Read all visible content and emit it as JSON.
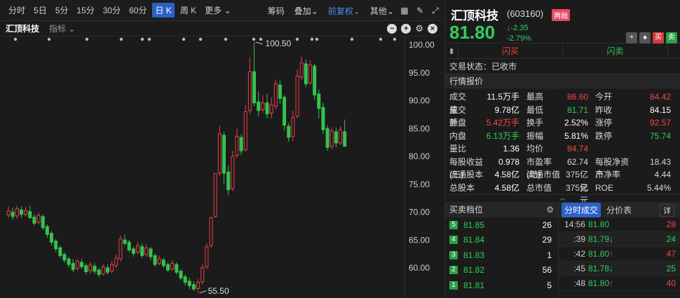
{
  "toolbar": {
    "items": [
      "分时",
      "5日",
      "5分",
      "15分",
      "30分",
      "60分",
      "日 K",
      "周 K",
      "更多"
    ],
    "active": "日 K",
    "right": [
      "筹码",
      "叠加",
      "前复权",
      "其他"
    ],
    "right_active": "前复权"
  },
  "subbar": {
    "stock": "汇顶科技",
    "indicator": "指标"
  },
  "stock": {
    "name": "汇顶科技",
    "code": "(603160)",
    "badge": "两融",
    "price": "81.80",
    "change": "-2.35",
    "change_pct": "-2.79%"
  },
  "trade": {
    "buy": "闪买",
    "sell": "闪卖"
  },
  "status": "交易状态：已收市",
  "quote_title": "行情报价",
  "quotes": [
    {
      "l1": "成交量",
      "v1": "11.5万手",
      "l2": "最高",
      "v2": "86.60",
      "c2": "red",
      "l3": "今开",
      "v3": "84.42",
      "c3": "red"
    },
    {
      "l1": "成交额",
      "v1": "9.78亿",
      "l2": "最低",
      "v2": "81.71",
      "c2": "green",
      "l3": "昨收",
      "v3": "84.15",
      "c3": "white"
    },
    {
      "l1": "外盘",
      "v1": "5.42万手",
      "c1": "red",
      "l2": "换手",
      "v2": "2.52%",
      "c2": "white",
      "l3": "涨停",
      "v3": "92.57",
      "c3": "red"
    },
    {
      "l1": "内盘",
      "v1": "6.13万手",
      "c1": "green",
      "l2": "振幅",
      "v2": "5.81%",
      "c2": "white",
      "l3": "跌停",
      "v3": "75.74",
      "c3": "green"
    },
    {
      "l1": "量比",
      "v1": "1.36",
      "l2": "均价",
      "v2": "84.74",
      "c2": "red",
      "l3": "",
      "v3": ""
    }
  ],
  "quotes_wide": [
    {
      "l1": "每股收益(三)",
      "v1": "0.978",
      "l2": "市盈率(动)",
      "v2": "62.74",
      "l3": "每股净资产",
      "v3": "18.43"
    },
    {
      "l1": "流通股本",
      "v1": "4.58亿",
      "l2": "流通市值",
      "v2": "375亿元",
      "l3": "市净率",
      "v3": "4.44"
    },
    {
      "l1": "总股本",
      "v1": "4.58亿",
      "l2": "总市值",
      "v2": "375亿元",
      "l3": "ROE",
      "v3": "5.44%"
    }
  ],
  "book": {
    "title": "买卖档位",
    "rows": [
      {
        "lvl": "5",
        "price": "81.85",
        "vol": "26"
      },
      {
        "lvl": "4",
        "price": "81.84",
        "vol": "29"
      },
      {
        "lvl": "3",
        "price": "81.83",
        "vol": "1"
      },
      {
        "lvl": "2",
        "price": "81.82",
        "vol": "56"
      },
      {
        "lvl": "1",
        "price": "81.81",
        "vol": "5"
      }
    ]
  },
  "ticks": {
    "tab1": "分时成交",
    "tab2": "分价表",
    "detail": "详",
    "rows": [
      {
        "t": "14:56",
        "p": "81.80",
        "d": "",
        "v": "28",
        "vc": "red"
      },
      {
        "t": ":39",
        "p": "81.79",
        "d": "↓",
        "v": "24",
        "vc": "green"
      },
      {
        "t": ":42",
        "p": "81.80",
        "d": "↑",
        "v": "47",
        "vc": "red"
      },
      {
        "t": ":45",
        "p": "81.78",
        "d": "↓",
        "v": "25",
        "vc": "green"
      },
      {
        "t": ":48",
        "p": "81.80",
        "d": "↑",
        "v": "40",
        "vc": "red"
      }
    ]
  },
  "chart_data": {
    "type": "candlestick",
    "y_ticks": [
      "100.00",
      "95.00",
      "90.00",
      "85.00",
      "80.00",
      "75.00",
      "70.00",
      "65.00",
      "60.00"
    ],
    "ylim": [
      58,
      101
    ],
    "annotations": [
      {
        "label": "100.50",
        "value": 100.5
      },
      {
        "label": "55.50",
        "value": 55.5
      }
    ],
    "candles": [
      [
        69.5,
        70.2,
        71.0,
        69.0
      ],
      [
        70.0,
        69.2,
        70.8,
        68.6
      ],
      [
        69.3,
        70.6,
        71.2,
        68.8
      ],
      [
        70.4,
        69.6,
        71.0,
        69.0
      ],
      [
        69.6,
        70.3,
        70.9,
        69.2
      ],
      [
        70.1,
        69.0,
        71.2,
        68.8
      ],
      [
        69.1,
        68.0,
        69.6,
        67.6
      ],
      [
        68.2,
        69.4,
        69.9,
        67.8
      ],
      [
        69.2,
        67.2,
        69.6,
        66.8
      ],
      [
        67.4,
        66.0,
        67.8,
        65.4
      ],
      [
        66.2,
        64.6,
        66.6,
        64.0
      ],
      [
        64.8,
        63.4,
        65.2,
        62.9
      ],
      [
        63.6,
        62.2,
        64.0,
        61.8
      ],
      [
        62.4,
        61.4,
        62.8,
        60.9
      ],
      [
        61.6,
        60.6,
        62.0,
        60.0
      ],
      [
        60.8,
        59.7,
        61.6,
        59.2
      ],
      [
        59.9,
        61.2,
        61.6,
        59.5
      ],
      [
        61.0,
        60.2,
        61.6,
        59.8
      ],
      [
        60.4,
        59.3,
        60.8,
        58.8
      ],
      [
        59.5,
        60.5,
        61.0,
        59.0
      ],
      [
        60.3,
        59.4,
        60.9,
        58.9
      ],
      [
        59.6,
        58.8,
        60.0,
        58.3
      ],
      [
        58.9,
        60.2,
        60.6,
        58.6
      ],
      [
        60.0,
        59.2,
        60.6,
        58.8
      ],
      [
        59.4,
        60.6,
        61.2,
        59.0
      ],
      [
        60.4,
        61.8,
        62.4,
        60.0
      ],
      [
        61.6,
        65.2,
        65.8,
        61.2
      ],
      [
        65.0,
        64.4,
        66.0,
        64.0
      ],
      [
        64.6,
        63.2,
        65.0,
        62.8
      ],
      [
        63.4,
        62.6,
        63.8,
        62.0
      ],
      [
        62.8,
        64.0,
        64.6,
        62.4
      ],
      [
        63.8,
        62.2,
        64.4,
        61.8
      ],
      [
        62.4,
        63.6,
        64.2,
        62.0
      ],
      [
        63.4,
        62.0,
        63.8,
        61.4
      ],
      [
        62.2,
        60.6,
        62.6,
        60.2
      ],
      [
        60.8,
        61.6,
        62.2,
        60.4
      ],
      [
        61.4,
        60.4,
        61.8,
        60.0
      ],
      [
        60.6,
        59.6,
        61.0,
        59.2
      ],
      [
        59.8,
        60.8,
        61.4,
        59.4
      ],
      [
        60.6,
        59.2,
        61.0,
        58.8
      ],
      [
        59.4,
        58.2,
        59.8,
        57.8
      ],
      [
        58.4,
        57.4,
        58.8,
        56.9
      ],
      [
        57.6,
        56.8,
        58.2,
        56.2
      ],
      [
        57.0,
        56.2,
        57.6,
        55.8
      ],
      [
        56.3,
        57.4,
        58.0,
        55.5
      ],
      [
        57.5,
        60.0,
        60.6,
        57.0
      ],
      [
        60.2,
        63.8,
        64.4,
        59.8
      ],
      [
        64.0,
        69.0,
        69.2,
        63.6
      ],
      [
        69.2,
        76.9,
        76.9,
        69.0
      ],
      [
        77.0,
        84.0,
        85.5,
        76.5
      ],
      [
        83.8,
        77.0,
        84.4,
        75.0
      ],
      [
        77.2,
        74.0,
        78.4,
        73.0
      ],
      [
        74.2,
        80.0,
        81.0,
        73.8
      ],
      [
        80.2,
        83.6,
        85.0,
        79.6
      ],
      [
        83.4,
        81.0,
        84.0,
        80.2
      ],
      [
        81.2,
        88.0,
        89.2,
        80.8
      ],
      [
        88.2,
        95.2,
        97.8,
        87.6
      ],
      [
        95.2,
        89.6,
        100.5,
        89.0
      ],
      [
        89.8,
        88.2,
        91.6,
        87.2
      ],
      [
        88.4,
        89.6,
        91.0,
        87.8
      ],
      [
        89.6,
        87.6,
        91.2,
        86.8
      ],
      [
        87.8,
        89.2,
        90.6,
        86.8
      ],
      [
        89.0,
        93.0,
        93.8,
        88.4
      ],
      [
        92.8,
        90.4,
        93.6,
        89.4
      ],
      [
        90.6,
        85.6,
        91.0,
        84.6
      ],
      [
        85.4,
        83.4,
        86.0,
        82.6
      ],
      [
        83.6,
        87.0,
        88.2,
        82.8
      ],
      [
        87.2,
        94.4,
        95.6,
        86.8
      ],
      [
        94.2,
        96.8,
        97.9,
        93.6
      ],
      [
        96.6,
        93.0,
        97.4,
        92.4
      ],
      [
        93.2,
        96.4,
        97.2,
        92.8
      ],
      [
        96.2,
        91.0,
        96.6,
        90.2
      ],
      [
        91.2,
        88.6,
        92.0,
        86.8
      ],
      [
        88.8,
        84.8,
        89.6,
        84.0
      ],
      [
        85.0,
        81.6,
        85.6,
        81.0
      ],
      [
        81.8,
        84.6,
        85.2,
        81.2
      ],
      [
        84.4,
        82.4,
        85.2,
        81.6
      ],
      [
        82.4,
        84.8,
        85.4,
        82.0
      ],
      [
        84.42,
        81.8,
        86.6,
        81.71
      ]
    ]
  }
}
